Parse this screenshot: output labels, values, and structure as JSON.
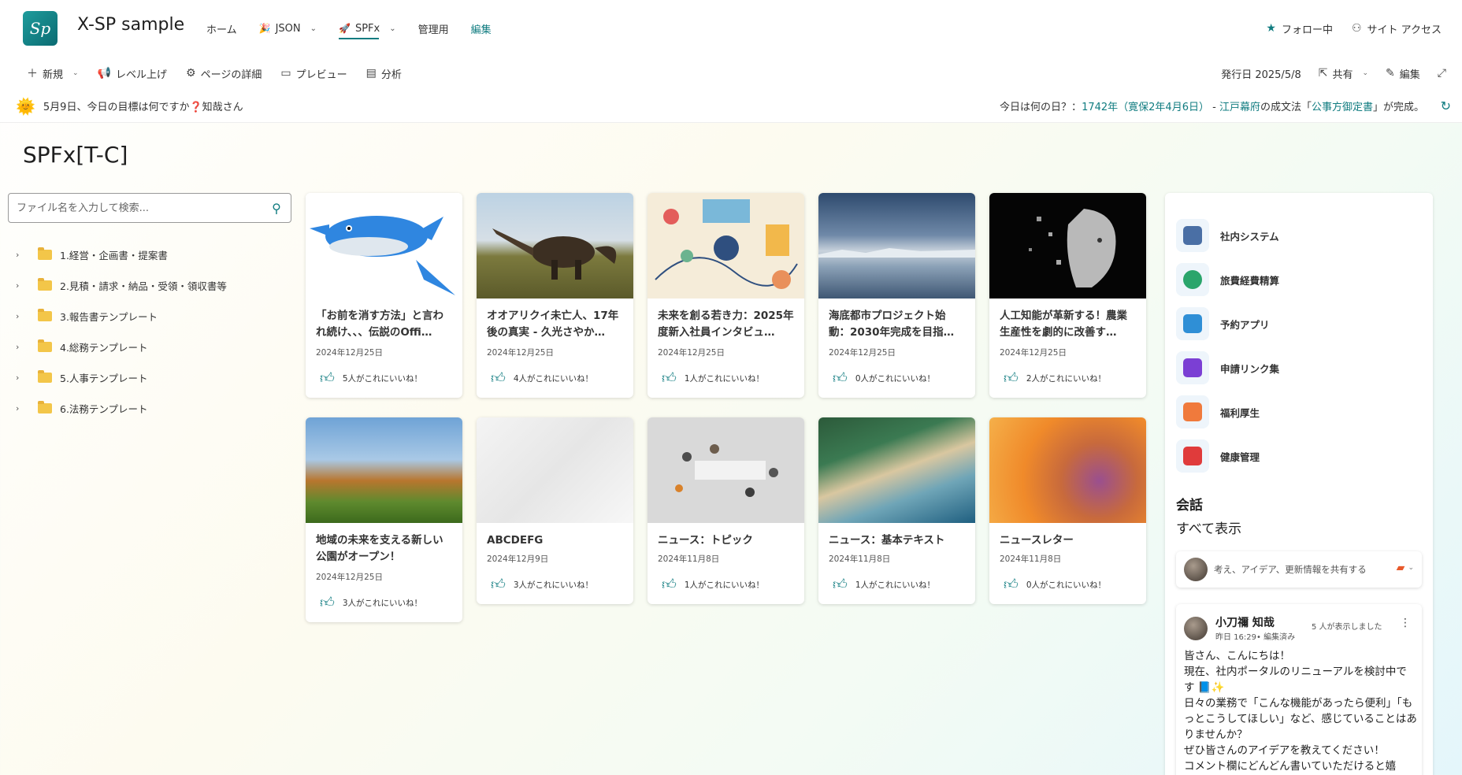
{
  "site": {
    "logo_text": "Sp",
    "title": "X-SP sample"
  },
  "nav": {
    "items": [
      {
        "label": "ホーム",
        "emoji": "",
        "has_chevron": false
      },
      {
        "label": "JSON",
        "emoji": "🎉",
        "has_chevron": true
      },
      {
        "label": "SPFx",
        "emoji": "🚀",
        "has_chevron": true
      },
      {
        "label": "管理用",
        "emoji": "",
        "has_chevron": false
      }
    ],
    "edit_label": "編集",
    "active": "SPFx"
  },
  "top_right": {
    "follow_label": "フォロー中",
    "access_label": "サイト アクセス"
  },
  "commands": {
    "new_label": "新規",
    "promote_label": "レベル上げ",
    "details_label": "ページの詳細",
    "preview_label": "プレビュー",
    "analytics_label": "分析",
    "published": "発行日 2025/5/8",
    "share_label": "共有",
    "edit_label": "編集"
  },
  "infobar": {
    "greeting": "5月9日、今日の目標は何ですか❓知哉さん",
    "today_prefix": "今日は何の日？：",
    "today_date": "1742年（寛保2年4月6日）",
    "today_sep": " - ",
    "today_subject": "江戸幕府",
    "today_mid": "の成文法「",
    "today_law": "公事方御定書",
    "today_suffix": "」が完成。"
  },
  "page": {
    "title": "SPFx[T-C]"
  },
  "search": {
    "placeholder": "ファイル名を入力して検索..."
  },
  "tree": [
    "1.経営・企画書・提案書",
    "2.見積・請求・納品・受領・領収書等",
    "3.報告書テンプレート",
    "4.総務テンプレート",
    "5.人事テンプレート",
    "6.法務テンプレート"
  ],
  "news": [
    {
      "title": "「お前を消す方法」と言われ続け、、、伝説のOffi…",
      "date": "2024年12月25日",
      "likes": "5人がこれにいいね！",
      "liked": true
    },
    {
      "title": "オオアリクイ未亡人、17年後の真実 - 久光さやか…",
      "date": "2024年12月25日",
      "likes": "4人がこれにいいね！",
      "liked": false
    },
    {
      "title": "未来を創る若き力：2025年度新入社員インタビュ…",
      "date": "2024年12月25日",
      "likes": "1人がこれにいいね！",
      "liked": false
    },
    {
      "title": "海底都市プロジェクト始動：2030年完成を目指…",
      "date": "2024年12月25日",
      "likes": "0人がこれにいいね！",
      "liked": false
    },
    {
      "title": "人工知能が革新する！農業生産性を劇的に改善す…",
      "date": "2024年12月25日",
      "likes": "2人がこれにいいね！",
      "liked": true
    },
    {
      "title": "地域の未来を支える新しい公園がオープン！",
      "date": "2024年12月25日",
      "likes": "3人がこれにいいね！",
      "liked": false
    },
    {
      "title": "ABCDEFG",
      "date": "2024年12月9日",
      "likes": "3人がこれにいいね！",
      "liked": true
    },
    {
      "title": "ニュース：トピック",
      "date": "2024年11月8日",
      "likes": "1人がこれにいいね！",
      "liked": false
    },
    {
      "title": "ニュース：基本テキスト",
      "date": "2024年11月8日",
      "likes": "1人がこれにいいね！",
      "liked": false
    },
    {
      "title": "ニュースレター",
      "date": "2024年11月8日",
      "likes": "0人がこれにいいね！",
      "liked": false
    }
  ],
  "apps": [
    {
      "name": "社内システム",
      "color": "#4a6fa5"
    },
    {
      "name": "旅費経費精算",
      "color": "#2aa56b"
    },
    {
      "name": "予約アプリ",
      "color": "#2f8fd6"
    },
    {
      "name": "申請リンク集",
      "color": "#7b3fd4"
    },
    {
      "name": "福利厚生",
      "color": "#f07a3c"
    },
    {
      "name": "健康管理",
      "color": "#e03b3b"
    }
  ],
  "conversation": {
    "title": "会話",
    "see_all": "すべて表示",
    "share_prompt": "考え、アイデア、更新情報を共有する",
    "post": {
      "author": "小刀禰 知哉",
      "meta": "昨日 16:29• 編集済み",
      "views": "5 人が表示しました",
      "lines": [
        "皆さん、こんにちは！",
        "現在、社内ポータルのリニューアルを検討中です 📘✨",
        "日々の業務で「こんな機能があったら便利」「もっとこうしてほしい」など、感じていることはありませんか？",
        "ぜひ皆さんのアイデアを教えてください！",
        "コメント欄にどんどん書いていただけると嬉"
      ]
    }
  },
  "colors": {
    "accent": "#107c80",
    "like": "#107c80"
  }
}
